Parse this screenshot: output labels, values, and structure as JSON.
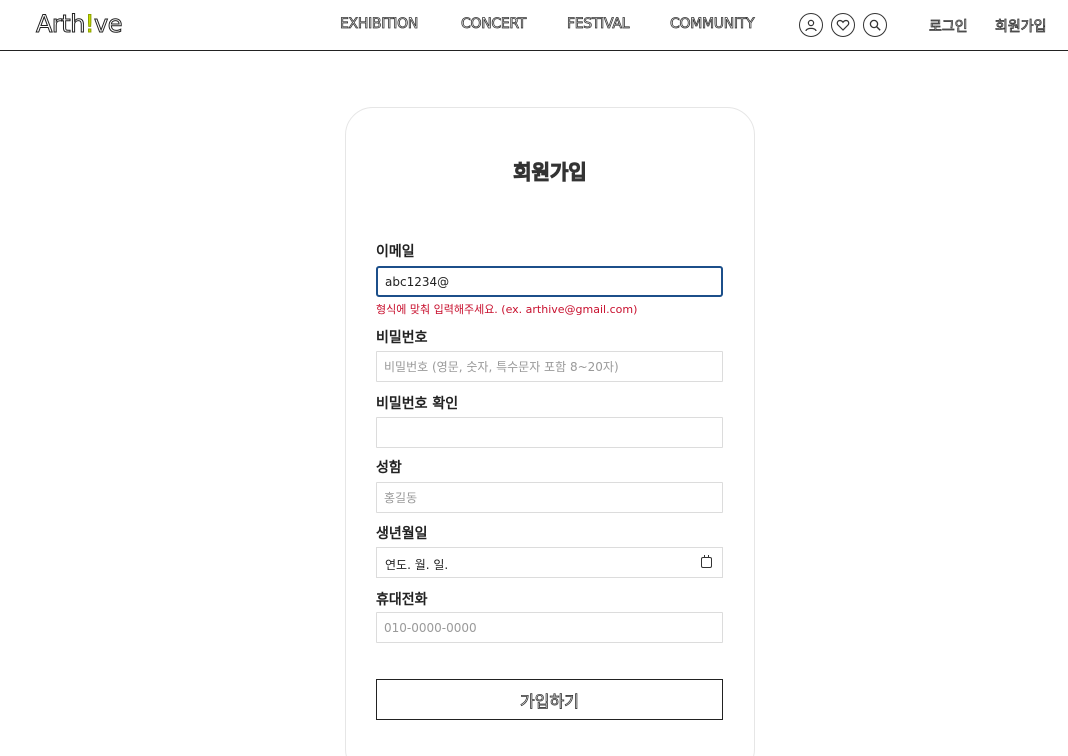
{
  "header": {
    "logo_prefix": "Arth",
    "logo_bang": "!",
    "logo_suffix": "ve",
    "nav": [
      "EXHIBITION",
      "CONCERT",
      "FESTIVAL",
      "COMMUNITY"
    ],
    "icons": [
      "user-icon",
      "heart-icon",
      "search-icon"
    ],
    "login_label": "로그인",
    "signup_label": "회원가입"
  },
  "form": {
    "title": "회원가입",
    "email": {
      "label": "이메일",
      "value": "abc1234@",
      "error": "형식에 맞춰 입력해주세요. (ex. arthive@gmail.com)"
    },
    "password": {
      "label": "비밀번호",
      "placeholder": "비밀번호 (영문, 숫자, 특수문자 포함 8~20자)"
    },
    "password_confirm": {
      "label": "비밀번호 확인",
      "placeholder": ""
    },
    "name": {
      "label": "성함",
      "placeholder": "홍길동"
    },
    "birth": {
      "label": "생년월일",
      "value": "연도. 월. 일."
    },
    "phone": {
      "label": "휴대전화",
      "placeholder": "010-0000-0000"
    },
    "submit_label": "가입하기"
  },
  "colors": {
    "accent_logo": "#c6e000",
    "focus_border": "#1c4f8a",
    "error": "#c8102e"
  }
}
